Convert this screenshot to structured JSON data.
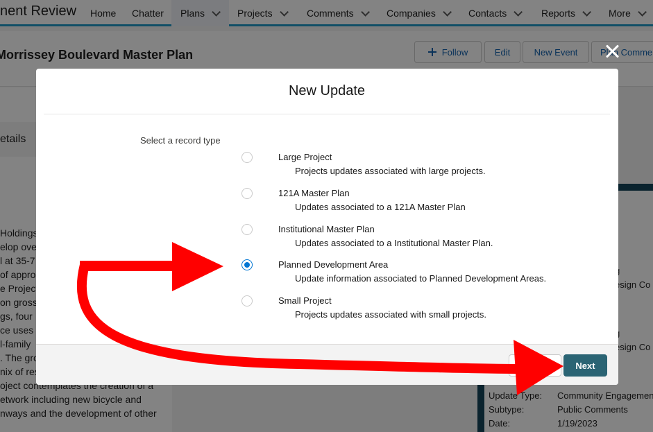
{
  "app": {
    "name": "nent Review"
  },
  "nav": {
    "items": [
      {
        "label": "Home",
        "has_menu": false
      },
      {
        "label": "Chatter",
        "has_menu": false
      },
      {
        "label": "Plans",
        "has_menu": true,
        "active": true
      },
      {
        "label": "Projects",
        "has_menu": true
      },
      {
        "label": "Comments",
        "has_menu": true
      },
      {
        "label": "Companies",
        "has_menu": true
      },
      {
        "label": "Contacts",
        "has_menu": true
      },
      {
        "label": "Reports",
        "has_menu": true
      },
      {
        "label": "More",
        "has_menu": true
      }
    ]
  },
  "record": {
    "title": "Morrissey Boulevard Master Plan",
    "actions": {
      "follow": "Follow",
      "edit": "Edit",
      "new_event": "New Event",
      "plan_comment": "Plan Comme"
    }
  },
  "left_panel": {
    "tab_label": "etails",
    "body_lines": [
      "Holdings",
      "elop ove",
      "l at 35-7",
      "of appro",
      "e Project",
      "on gross",
      "gs, four",
      "ce uses",
      "l-family",
      ". The gro",
      "nix of res",
      "oject contemplates the creation of a",
      "etwork including new bicycle and",
      "nways and the development of other"
    ]
  },
  "right_panel": {
    "fragments": [
      "g",
      "esign Co",
      "g",
      "esign Co"
    ],
    "details": [
      {
        "label": "Update Type:",
        "value": "Community Engagemen"
      },
      {
        "label": "Subtype:",
        "value": "Public Comments"
      },
      {
        "label": "Date:",
        "value": "1/19/2023"
      }
    ]
  },
  "modal": {
    "title": "New Update",
    "field_label": "Select a record type",
    "options": [
      {
        "label": "Large Project",
        "description": "Projects updates associated with large projects.",
        "selected": false
      },
      {
        "label": "121A Master Plan",
        "description": "Updates associated to a 121A Master Plan",
        "selected": false
      },
      {
        "label": "Institutional Master Plan",
        "description": "Updates associated to a Institutional Master Plan.",
        "selected": false
      },
      {
        "label": "Planned Development Area",
        "description": "Update information associated to Planned Development Areas.",
        "selected": true
      },
      {
        "label": "Small Project",
        "description": "Projects updates associated with small projects.",
        "selected": false
      }
    ],
    "cancel_label": "",
    "next_label": "Next"
  },
  "colors": {
    "nav_accent": "#1b96c6",
    "primary_button": "#2b6474",
    "radio_selected": "#0176d3",
    "annotation_arrow": "#ff0000"
  },
  "icons": [
    "close-icon",
    "add-icon",
    "chevron-down-icon",
    "annotation-arrow"
  ]
}
